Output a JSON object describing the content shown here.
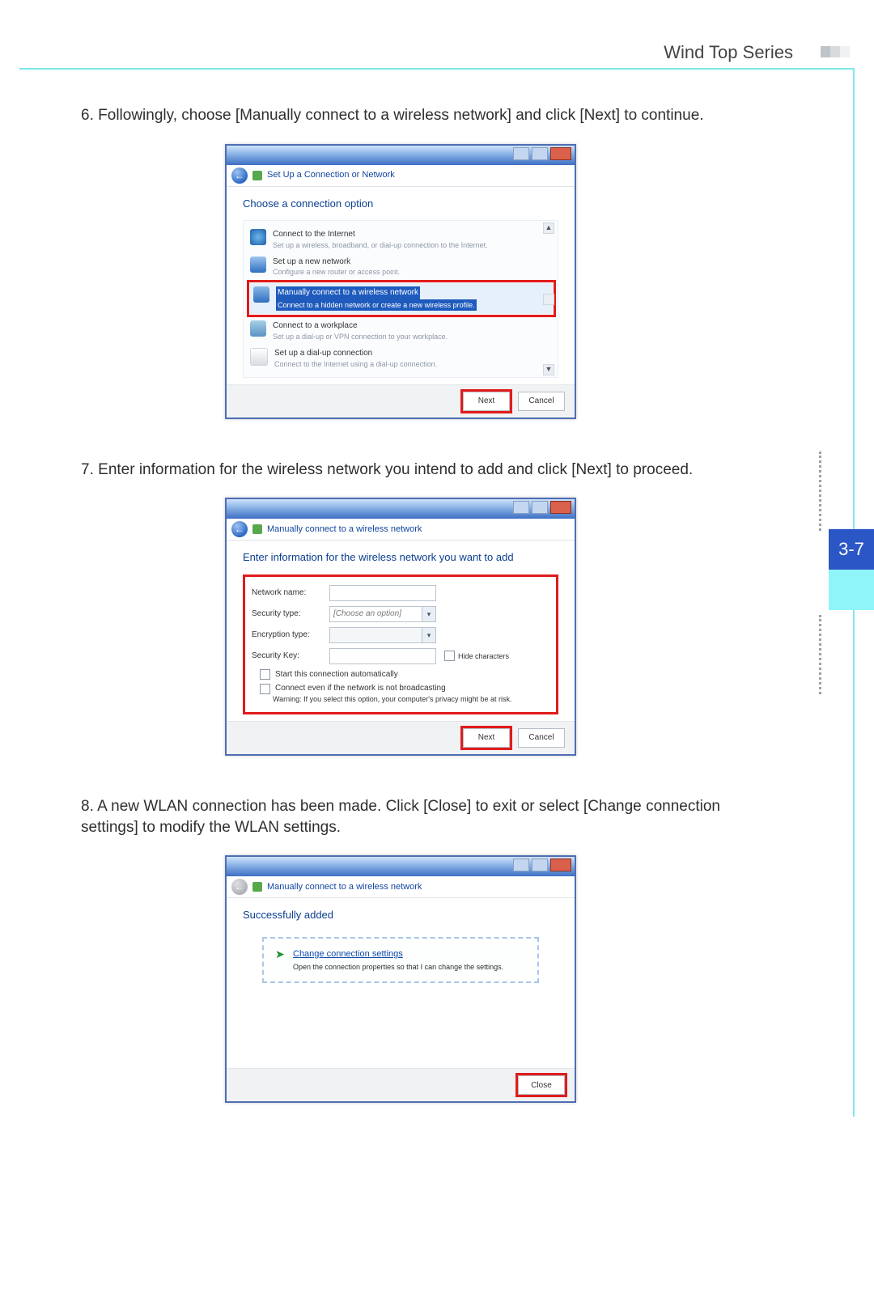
{
  "header": {
    "title": "Wind Top Series"
  },
  "pagetab": {
    "label": "3-7"
  },
  "steps": {
    "s6": {
      "num": "6.",
      "text": "Followingly, choose [Manually connect to a wireless network] and click [Next] to continue."
    },
    "s7": {
      "num": "7.",
      "text": "Enter information for the wireless network you intend to add and click [Next] to proceed."
    },
    "s8": {
      "num": "8.",
      "text": "A new WLAN connection has been made. Click [Close] to exit or select [Change connection settings] to modify the WLAN settings."
    }
  },
  "dlg1": {
    "breadcrumb": "Set Up a Connection or Network",
    "title": "Choose a connection option",
    "options": [
      {
        "t": "Connect to the Internet",
        "d": "Set up a wireless, broadband, or dial-up connection to the Internet."
      },
      {
        "t": "Set up a new network",
        "d": "Configure a new router or access point."
      },
      {
        "t": "Manually connect to a wireless network",
        "d": "Connect to a hidden network or create a new wireless profile."
      },
      {
        "t": "Connect to a workplace",
        "d": "Set up a dial-up or VPN connection to your workplace."
      },
      {
        "t": "Set up a dial-up connection",
        "d": "Connect to the Internet using a dial-up connection."
      }
    ],
    "next": "Next",
    "cancel": "Cancel"
  },
  "dlg2": {
    "breadcrumb": "Manually connect to a wireless network",
    "title": "Enter information for the wireless network you want to add",
    "labels": {
      "name": "Network name:",
      "sec": "Security type:",
      "enc": "Encryption type:",
      "key": "Security Key:"
    },
    "sec_ph": "[Choose an option]",
    "hide": "Hide characters",
    "auto": "Start this connection automatically",
    "nobcast": "Connect even if the network is not broadcasting",
    "warn": "Warning: If you select this option, your computer's privacy might be at risk.",
    "next": "Next",
    "cancel": "Cancel"
  },
  "dlg3": {
    "breadcrumb": "Manually connect to a wireless network",
    "title": "Successfully added",
    "ccs_title": "Change connection settings",
    "ccs_desc": "Open the connection properties so that I can change the settings.",
    "close": "Close"
  }
}
